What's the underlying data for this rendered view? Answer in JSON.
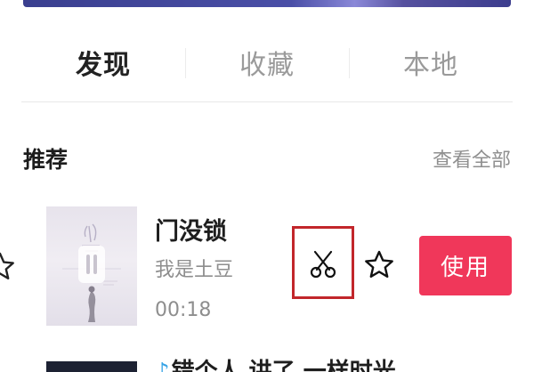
{
  "tabs": [
    {
      "label": "发现",
      "active": true
    },
    {
      "label": "收藏",
      "active": false
    },
    {
      "label": "本地",
      "active": false
    }
  ],
  "section": {
    "title": "推荐",
    "view_all": "查看全部"
  },
  "songs": [
    {
      "title": "门没锁",
      "artist": "我是土豆",
      "duration": "00:18",
      "use_label": "使用",
      "icons": [
        "scissors-icon",
        "star-outline-icon"
      ]
    }
  ],
  "next_row": {
    "note_icon": "♪",
    "title_partial": "错个人 讲了 一样时光"
  },
  "colors": {
    "accent": "#f0375a",
    "highlight": "#c2262b",
    "text_primary": "#222222",
    "text_secondary": "#8e8e8e",
    "note_blue": "#36a3e6"
  }
}
